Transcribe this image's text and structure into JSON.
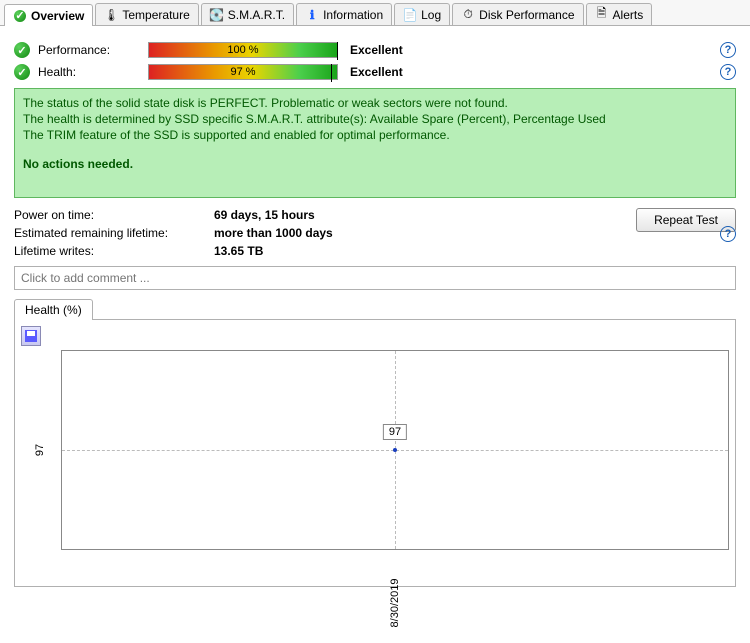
{
  "tabs": [
    {
      "label": "Overview",
      "icon": "check-circle-icon"
    },
    {
      "label": "Temperature",
      "icon": "thermometer-icon"
    },
    {
      "label": "S.M.A.R.T.",
      "icon": "drive-icon"
    },
    {
      "label": "Information",
      "icon": "info-icon"
    },
    {
      "label": "Log",
      "icon": "log-icon"
    },
    {
      "label": "Disk Performance",
      "icon": "gauge-icon"
    },
    {
      "label": "Alerts",
      "icon": "alerts-icon"
    }
  ],
  "metrics": {
    "performance": {
      "label": "Performance:",
      "value": "100 %",
      "status": "Excellent",
      "pct": 100
    },
    "health": {
      "label": "Health:",
      "value": "97 %",
      "status": "Excellent",
      "pct": 97
    }
  },
  "status": {
    "line1": "The status of the solid state disk is PERFECT. Problematic or weak sectors were not found.",
    "line2": "The health is determined by SSD specific S.M.A.R.T. attribute(s):  Available Spare (Percent), Percentage Used",
    "line3": "The TRIM feature of the SSD is supported and enabled for optimal performance.",
    "actions": "No actions needed."
  },
  "info": {
    "power_on_label": "Power on time:",
    "power_on_value": "69 days, 15 hours",
    "remaining_label": "Estimated remaining lifetime:",
    "remaining_value": "more than 1000 days",
    "writes_label": "Lifetime writes:",
    "writes_value": "13.65 TB"
  },
  "repeat_button": "Repeat Test",
  "comment_placeholder": "Click to add comment ...",
  "chart_tab": "Health (%)",
  "chart_data": {
    "type": "scatter",
    "x": [
      "8/30/2019"
    ],
    "y": [
      97
    ],
    "ylabel": "",
    "xlabel": "",
    "ylim": [
      90,
      100
    ],
    "point_label": "97",
    "ytick": "97",
    "xtick": "8/30/2019"
  }
}
